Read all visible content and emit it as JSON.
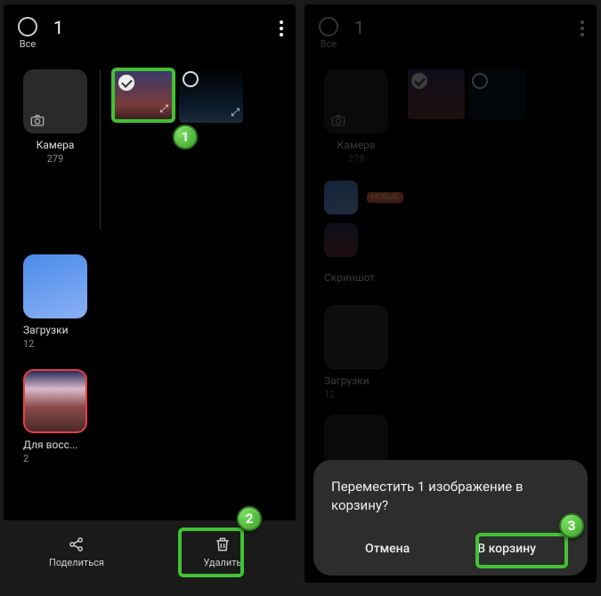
{
  "header": {
    "all_label": "Все",
    "count": "1"
  },
  "left": {
    "albums": [
      {
        "name": "Камера",
        "count": "279"
      },
      {
        "name": "Загрузки",
        "count": "12"
      },
      {
        "name": "Для восс...",
        "count": "2"
      }
    ]
  },
  "right": {
    "albums": [
      {
        "name": "Камера",
        "count": "279"
      },
      {
        "name": "Скриншот",
        "count": ""
      },
      {
        "name": "Загрузки",
        "count": "12"
      }
    ],
    "new_tag": "НОВЫЕ"
  },
  "bottombar": {
    "share": "Поделиться",
    "delete": "Удалить"
  },
  "dialog": {
    "title": "Переместить 1 изображение в корзину?",
    "cancel": "Отмена",
    "confirm": "В корзину"
  },
  "badges": {
    "b1": "1",
    "b2": "2",
    "b3": "3"
  }
}
